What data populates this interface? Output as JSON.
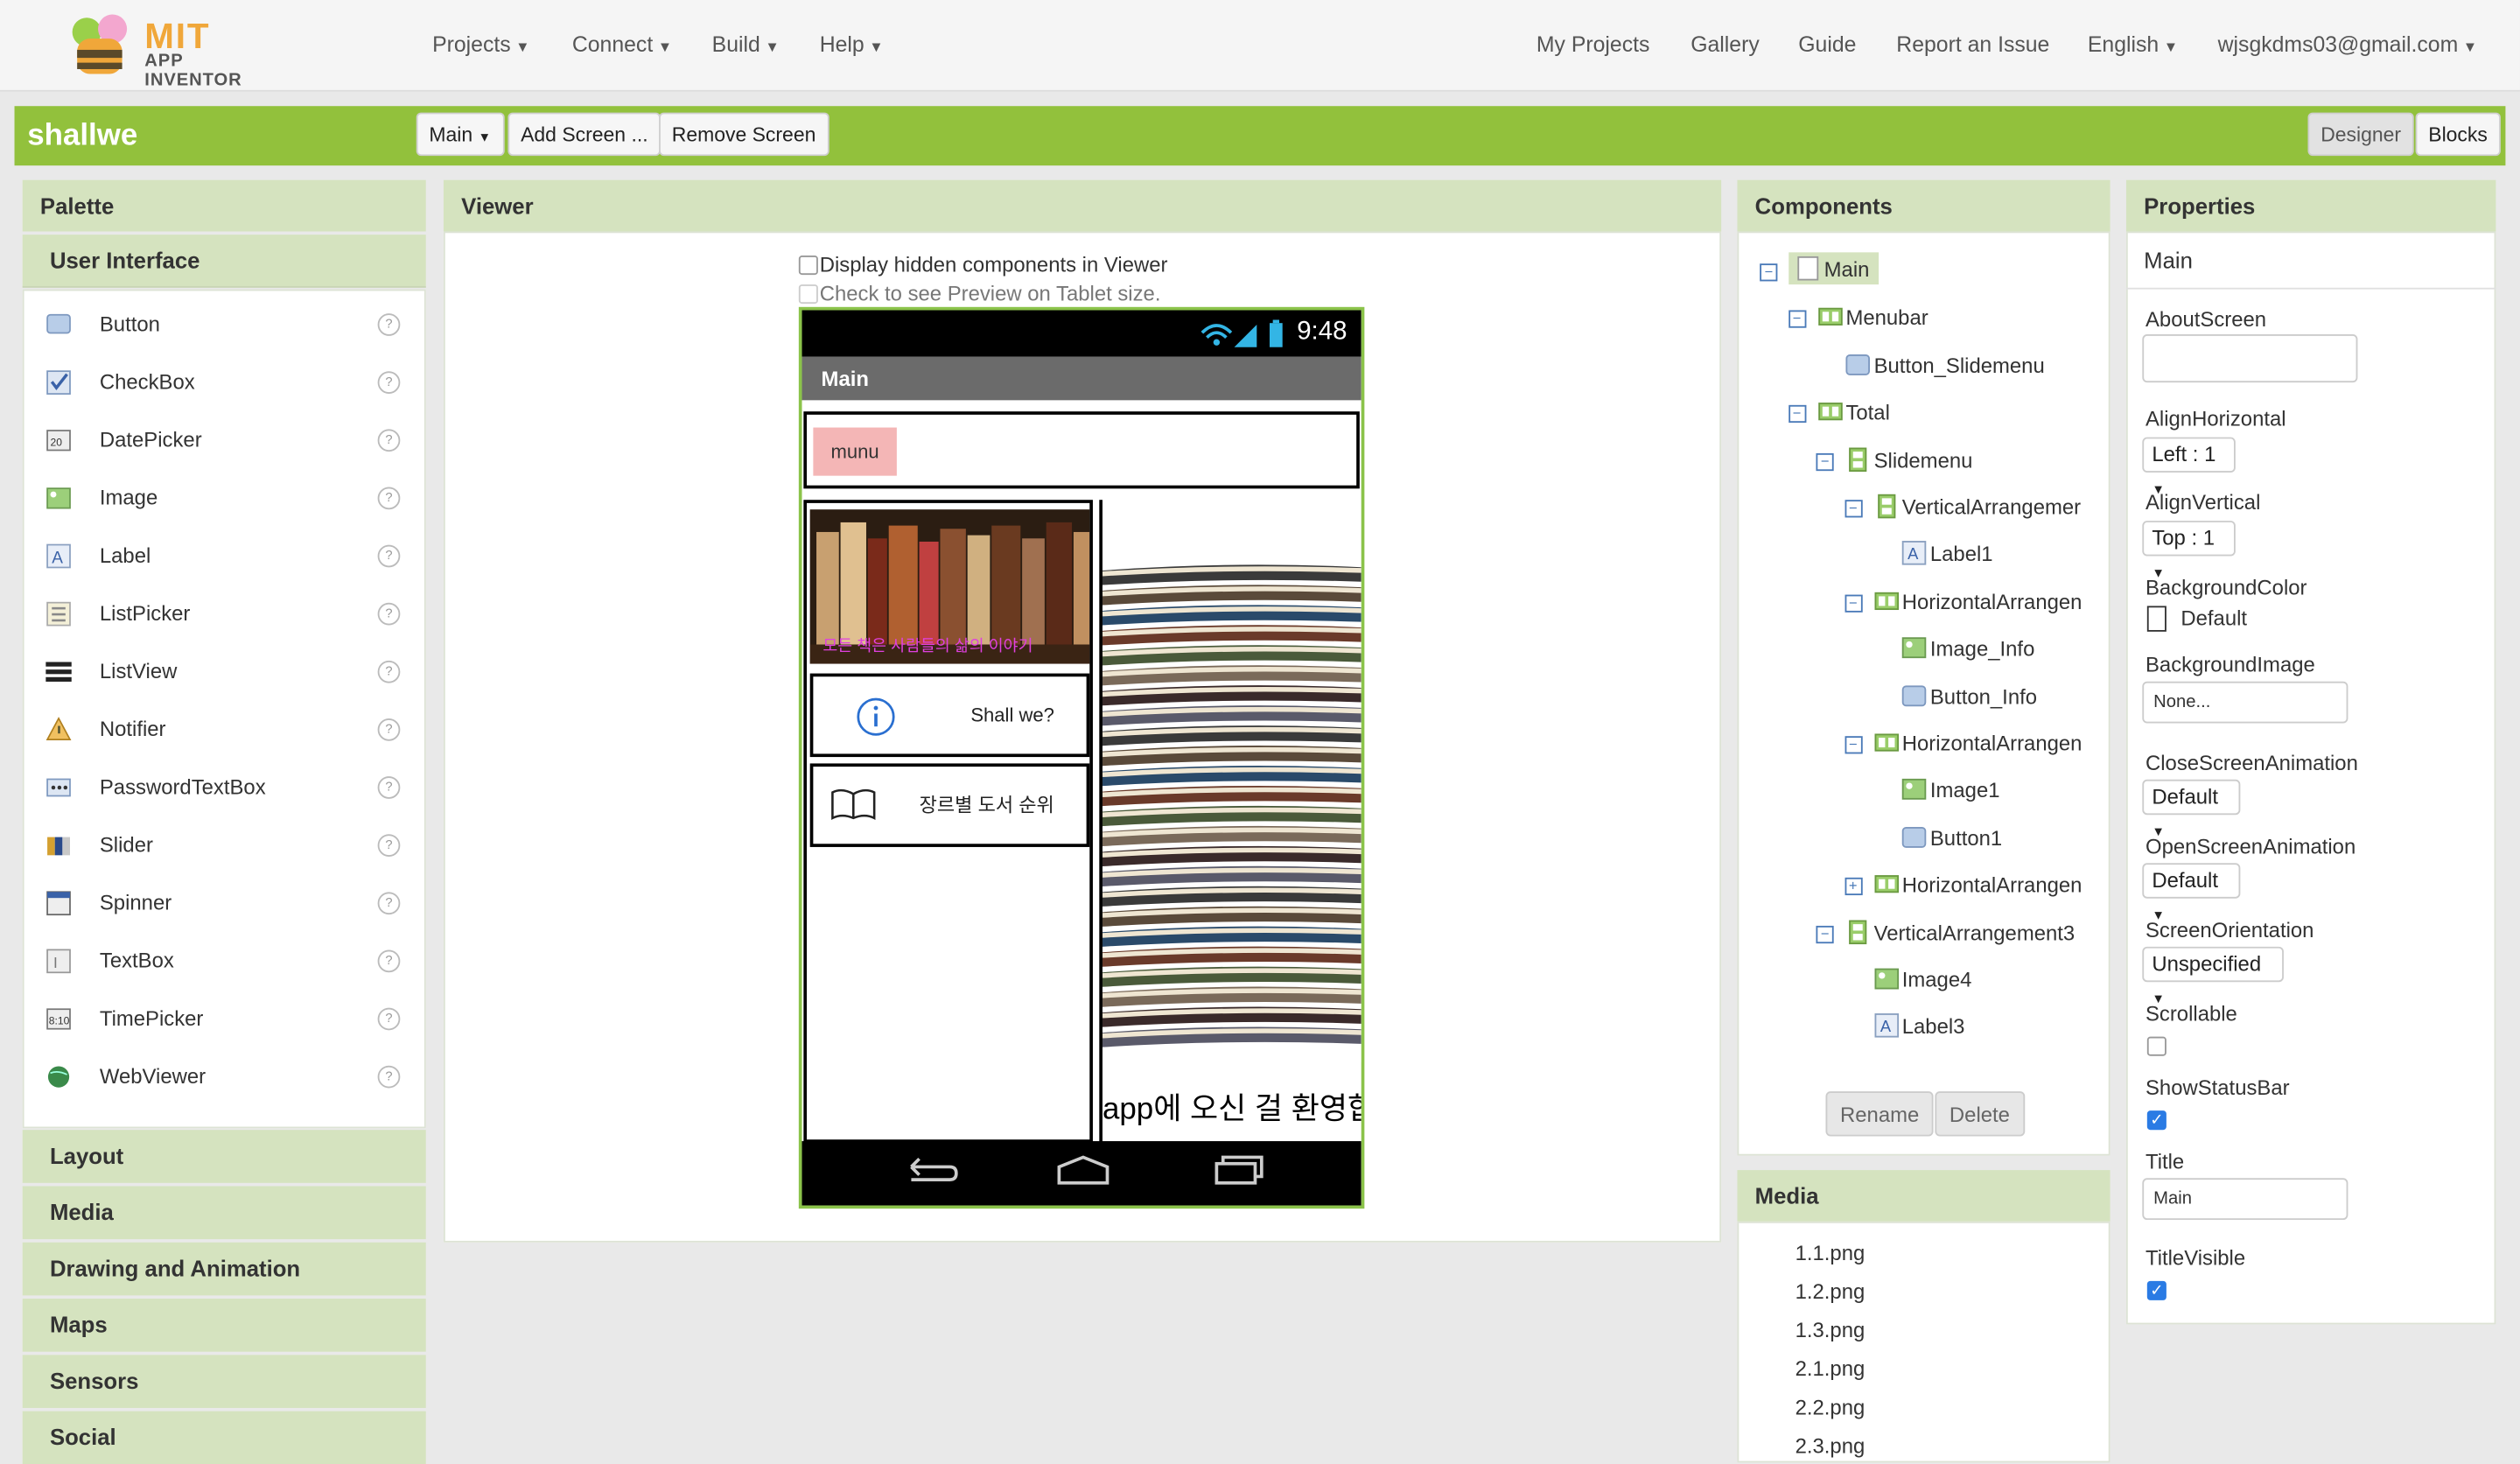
{
  "header": {
    "logo_text": "MIT",
    "logo_subtext": "APP INVENTOR",
    "menus": [
      "Projects",
      "Connect",
      "Build",
      "Help"
    ],
    "links": [
      "My Projects",
      "Gallery",
      "Guide",
      "Report an Issue"
    ],
    "language": "English",
    "account": "wjsgkdms03@gmail.com"
  },
  "toolbar": {
    "project_name": "shallwe",
    "screen_select": "Main",
    "add_screen": "Add Screen ...",
    "remove_screen": "Remove Screen",
    "designer": "Designer",
    "blocks": "Blocks"
  },
  "palette": {
    "title": "Palette",
    "open_category": "User Interface",
    "items": [
      {
        "label": "Button",
        "icon": "button-icon"
      },
      {
        "label": "CheckBox",
        "icon": "checkbox-icon"
      },
      {
        "label": "DatePicker",
        "icon": "datepicker-icon"
      },
      {
        "label": "Image",
        "icon": "image-icon"
      },
      {
        "label": "Label",
        "icon": "label-icon"
      },
      {
        "label": "ListPicker",
        "icon": "listpicker-icon"
      },
      {
        "label": "ListView",
        "icon": "listview-icon"
      },
      {
        "label": "Notifier",
        "icon": "notifier-icon"
      },
      {
        "label": "PasswordTextBox",
        "icon": "passwordtextbox-icon"
      },
      {
        "label": "Slider",
        "icon": "slider-icon"
      },
      {
        "label": "Spinner",
        "icon": "spinner-icon"
      },
      {
        "label": "TextBox",
        "icon": "textbox-icon"
      },
      {
        "label": "TimePicker",
        "icon": "timepicker-icon"
      },
      {
        "label": "WebViewer",
        "icon": "webviewer-icon"
      }
    ],
    "categories": [
      "Layout",
      "Media",
      "Drawing and Animation",
      "Maps",
      "Sensors",
      "Social"
    ]
  },
  "viewer": {
    "title": "Viewer",
    "hidden_components": "Display hidden components in Viewer",
    "tablet_preview": "Check to see Preview on Tablet size.",
    "phone": {
      "time": "9:48",
      "screen_title": "Main",
      "menu_button": "munu",
      "books_caption": "모든 책은 사람들의 삶의 이야기",
      "shall_we": "Shall we?",
      "genre_ranking": "장르별 도서 순위",
      "welcome": "app에 오신 걸 환영합"
    }
  },
  "components": {
    "title": "Components",
    "tree": [
      {
        "label": "Main",
        "depth": 0,
        "toggle": "minus",
        "type": "screen"
      },
      {
        "label": "Menubar",
        "depth": 1,
        "toggle": "minus",
        "type": "horizontal"
      },
      {
        "label": "Button_Slidemenu",
        "depth": 2,
        "toggle": "",
        "type": "button"
      },
      {
        "label": "Total",
        "depth": 1,
        "toggle": "minus",
        "type": "horizontal"
      },
      {
        "label": "Slidemenu",
        "depth": 2,
        "toggle": "minus",
        "type": "vertical"
      },
      {
        "label": "VerticalArrangemer",
        "depth": 3,
        "toggle": "minus",
        "type": "vertical"
      },
      {
        "label": "Label1",
        "depth": 4,
        "toggle": "",
        "type": "label"
      },
      {
        "label": "HorizontalArrangen",
        "depth": 3,
        "toggle": "minus",
        "type": "horizontal"
      },
      {
        "label": "Image_Info",
        "depth": 4,
        "toggle": "",
        "type": "image"
      },
      {
        "label": "Button_Info",
        "depth": 4,
        "toggle": "",
        "type": "button"
      },
      {
        "label": "HorizontalArrangen",
        "depth": 3,
        "toggle": "minus",
        "type": "horizontal"
      },
      {
        "label": "Image1",
        "depth": 4,
        "toggle": "",
        "type": "image"
      },
      {
        "label": "Button1",
        "depth": 4,
        "toggle": "",
        "type": "button"
      },
      {
        "label": "HorizontalArrangen",
        "depth": 3,
        "toggle": "plus",
        "type": "horizontal"
      },
      {
        "label": "VerticalArrangement3",
        "depth": 2,
        "toggle": "minus",
        "type": "vertical"
      },
      {
        "label": "Image4",
        "depth": 3,
        "toggle": "",
        "type": "image"
      },
      {
        "label": "Label3",
        "depth": 3,
        "toggle": "",
        "type": "label"
      }
    ],
    "rename": "Rename",
    "delete": "Delete"
  },
  "media": {
    "title": "Media",
    "files": [
      "1.1.png",
      "1.2.png",
      "1.3.png",
      "2.1.png",
      "2.2.png",
      "2.3.png"
    ]
  },
  "properties": {
    "title": "Properties",
    "component": "Main",
    "about_screen_label": "AboutScreen",
    "align_horizontal_label": "AlignHorizontal",
    "align_horizontal_value": "Left : 1",
    "align_vertical_label": "AlignVertical",
    "align_vertical_value": "Top : 1",
    "background_color_label": "BackgroundColor",
    "background_color_value": "Default",
    "background_image_label": "BackgroundImage",
    "background_image_value": "None...",
    "close_anim_label": "CloseScreenAnimation",
    "close_anim_value": "Default",
    "open_anim_label": "OpenScreenAnimation",
    "open_anim_value": "Default",
    "orientation_label": "ScreenOrientation",
    "orientation_value": "Unspecified",
    "scrollable_label": "Scrollable",
    "scrollable": false,
    "statusbar_label": "ShowStatusBar",
    "statusbar": true,
    "title_label": "Title",
    "title_value": "Main",
    "title_visible_label": "TitleVisible",
    "title_visible": true
  },
  "colors": {
    "brand_green": "#92c13c",
    "panel_header": "#d5e3bf",
    "checkbox_blue": "#2a7be4"
  }
}
